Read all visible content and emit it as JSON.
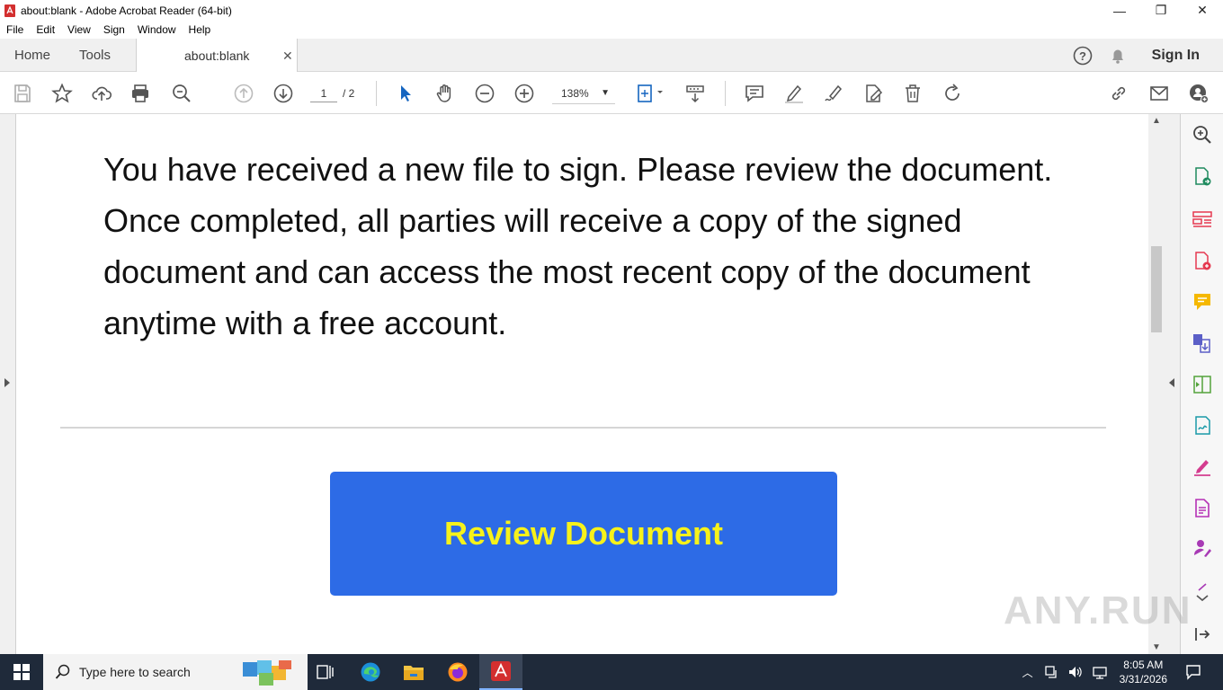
{
  "window": {
    "title": "about:blank - Adobe Acrobat Reader (64-bit)"
  },
  "menu": [
    "File",
    "Edit",
    "View",
    "Sign",
    "Window",
    "Help"
  ],
  "tabs": {
    "home": "Home",
    "tools": "Tools",
    "document": "about:blank",
    "sign_in": "Sign In"
  },
  "toolbar": {
    "page_current": "1",
    "page_total": "/ 2",
    "zoom": "138%"
  },
  "document": {
    "paragraph": "You have received a new file to sign. Please review the document. Once completed, all parties will receive a copy of the signed document and can access the most recent copy of the document anytime with a free account.",
    "button_label": "Review Document"
  },
  "watermark": "ANY.RUN",
  "taskbar": {
    "search_placeholder": "Type here to search",
    "time": "8:05 AM",
    "date": "3/31/2026"
  },
  "colors": {
    "cta_bg": "#2d6be6",
    "cta_text": "#f7f21a",
    "taskbar_bg": "#1f2a3a"
  }
}
